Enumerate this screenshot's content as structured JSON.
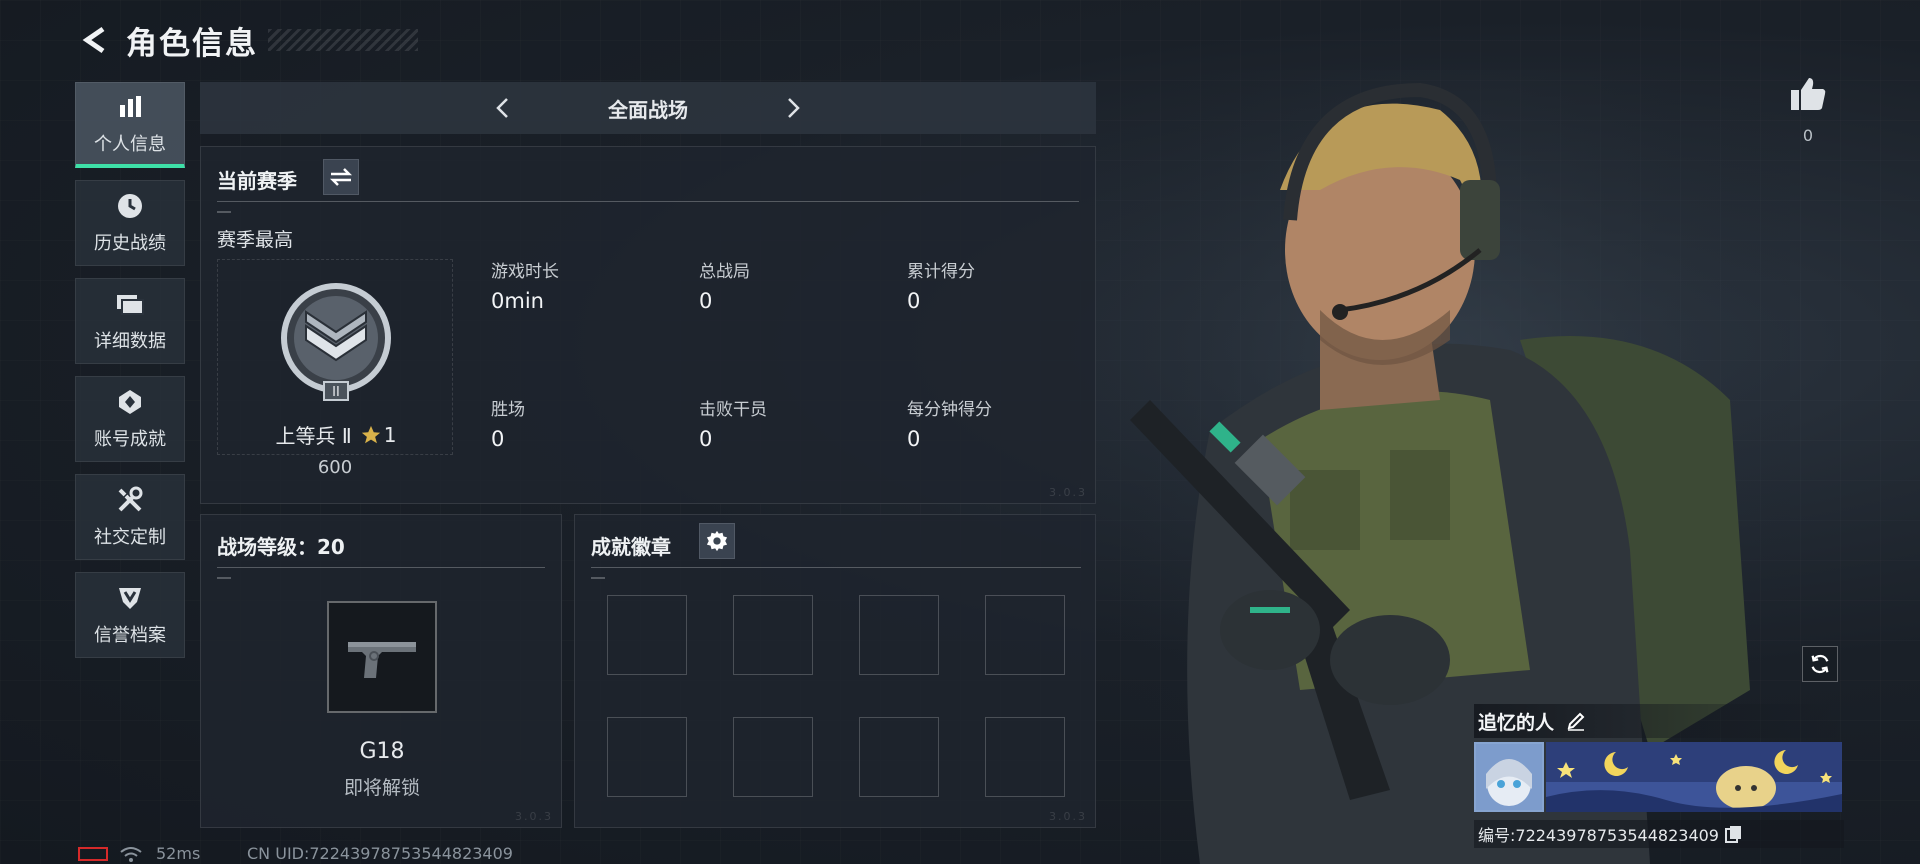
{
  "header": {
    "title": "角色信息"
  },
  "sidebar": {
    "items": [
      {
        "label": "个人信息",
        "icon": "bar-chart-icon"
      },
      {
        "label": "历史战绩",
        "icon": "clock-icon"
      },
      {
        "label": "详细数据",
        "icon": "folder-icon"
      },
      {
        "label": "账号成就",
        "icon": "medal-icon"
      },
      {
        "label": "社交定制",
        "icon": "tools-icon"
      },
      {
        "label": "信誉档案",
        "icon": "shield-icon"
      }
    ]
  },
  "mode": {
    "label": "全面战场"
  },
  "season": {
    "title": "当前赛季",
    "best_label": "赛季最高",
    "rank_name": "上等兵 Ⅱ",
    "rank_stars": "1",
    "rank_points": "600",
    "rank_badge_numeral": "II",
    "stats": [
      {
        "label": "游戏时长",
        "value": "0min"
      },
      {
        "label": "总战局",
        "value": "0"
      },
      {
        "label": "累计得分",
        "value": "0"
      },
      {
        "label": "胜场",
        "value": "0"
      },
      {
        "label": "击败干员",
        "value": "0"
      },
      {
        "label": "每分钟得分",
        "value": "0"
      }
    ],
    "corner_tag": "3.0.3"
  },
  "battlefield": {
    "level_label": "战场等级：20",
    "weapon_name": "G18",
    "weapon_status": "即将解锁",
    "corner_tag": "3.0.3"
  },
  "achievements": {
    "title": "成就徽章",
    "slot_count": 8,
    "corner_tag": "3.0.3"
  },
  "status": {
    "ping": "52ms",
    "uid": "CN UID:72243978753544823409"
  },
  "profile": {
    "likes": "0",
    "player_name": "追忆的人",
    "id_label": "编号:72243978753544823409"
  },
  "colors": {
    "accent": "#3ee0a8",
    "battery_low": "#d62a2a"
  }
}
